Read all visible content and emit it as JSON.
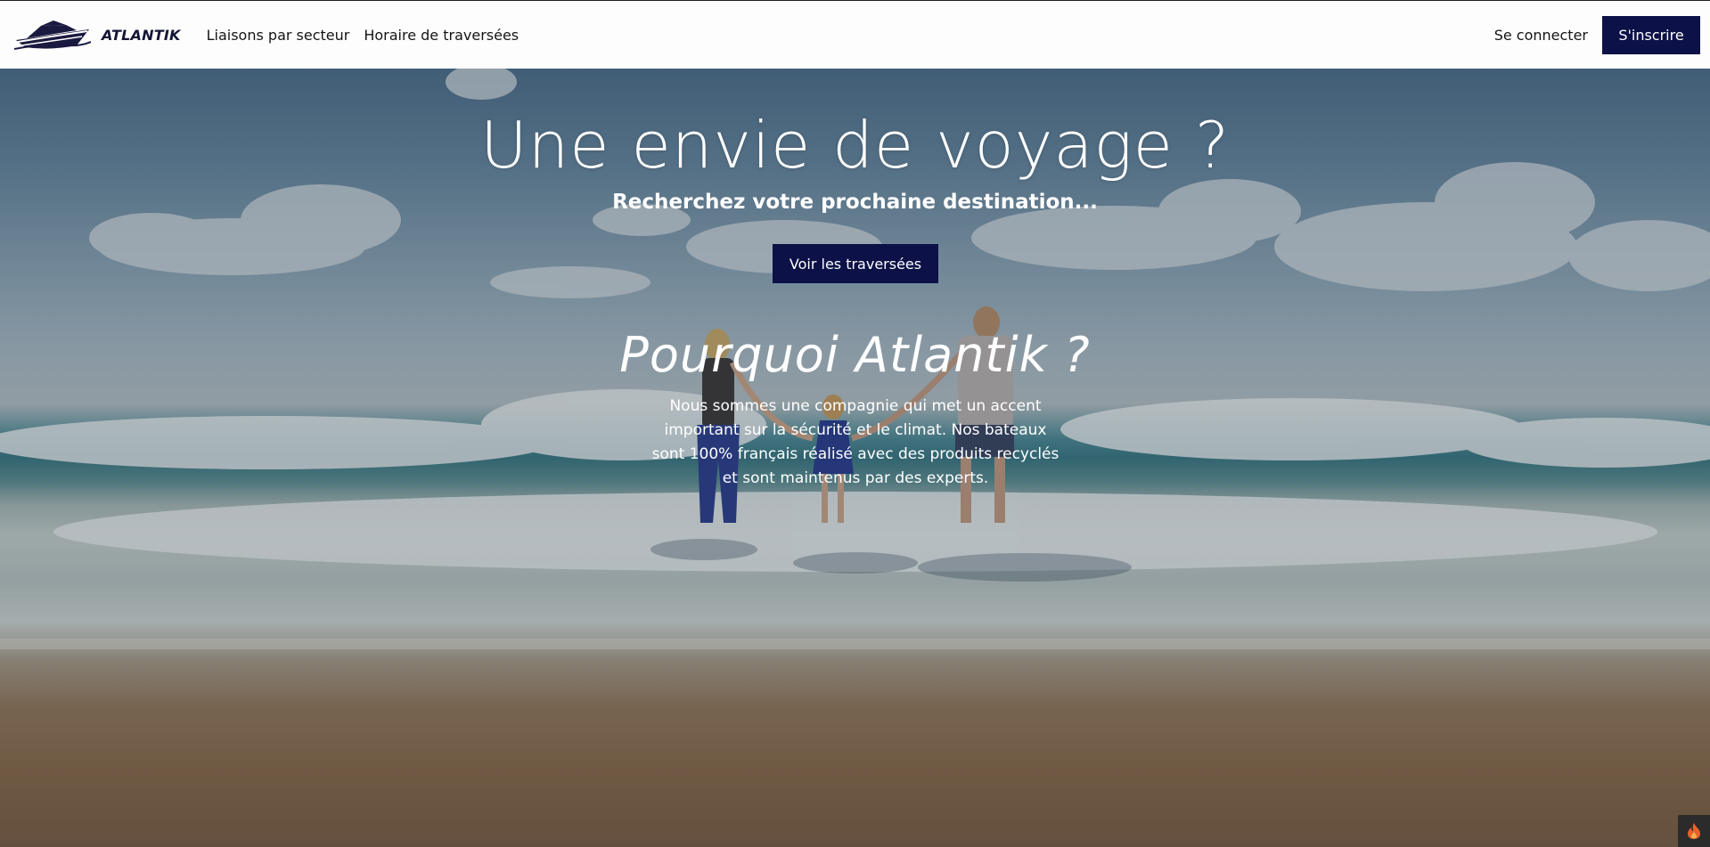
{
  "brand": {
    "name": "ATLANTIK",
    "logo_icon": "ship-logo-icon"
  },
  "nav": {
    "links": [
      "Liaisons par secteur",
      "Horaire de traversées"
    ],
    "login_label": "Se connecter",
    "signup_label": "S'inscrire"
  },
  "hero": {
    "title": "Une envie de voyage ?",
    "subtitle": "Recherchez votre prochaine destination...",
    "cta_label": "Voir les traversées",
    "why_title": "Pourquoi Atlantik ?",
    "why_text": "Nous sommes une compagnie qui met un accent important sur la sécurité et le climat. Nos bateaux sont 100% français réalisé avec des produits recyclés et sont maintenus par des experts."
  },
  "colors": {
    "primary": "#0c1147",
    "navbar_bg": "#fdfdfe",
    "text_dark": "#151515",
    "hero_text": "#ffffff"
  },
  "corner_badge": {
    "icon": "flame-icon"
  }
}
